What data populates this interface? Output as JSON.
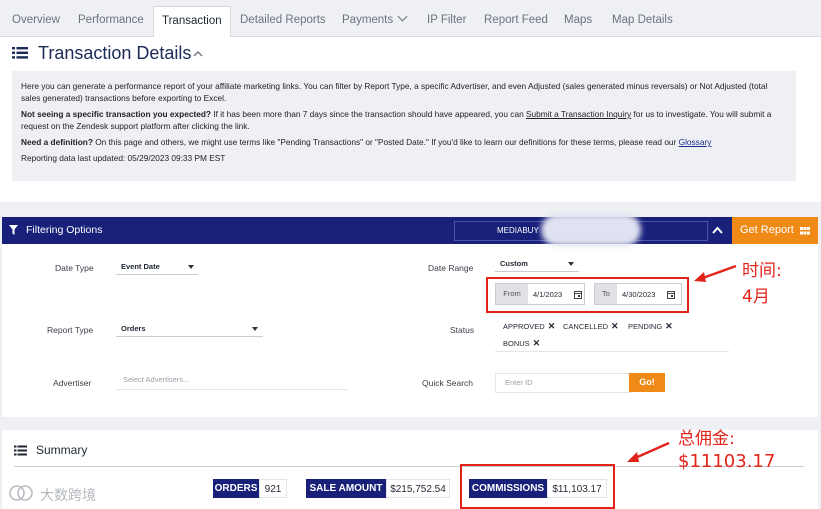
{
  "tabs": [
    {
      "label": "Overview",
      "active": false
    },
    {
      "label": "Performance",
      "active": false
    },
    {
      "label": "Transaction",
      "active": true
    },
    {
      "label": "Detailed Reports",
      "active": false
    },
    {
      "label": "Payments",
      "active": false
    },
    {
      "label": "IP Filter",
      "active": false
    },
    {
      "label": "Report Feed",
      "active": false
    },
    {
      "label": "Maps",
      "active": false
    },
    {
      "label": "Map Details",
      "active": false
    }
  ],
  "header": {
    "title": "Transaction Details"
  },
  "info": {
    "para1": "Here you can generate a performance report of your affiliate marketing links. You can filter by Report Type, a specific Advertiser, and even Adjusted (sales generated minus reversals) or Not Adjusted (total sales generated) transactions before exporting to Excel.",
    "q1_bold": "Not seeing a specific transaction you expected?",
    "q1_text_a": " If it has been more than 7 days since the transaction should have appeared, you can ",
    "q1_link": "Submit a Transaction Inquiry",
    "q1_text_b": " for us to investigate. You will submit a request on the Zendesk support platform after clicking the link.",
    "q2_bold": "Need a definition?",
    "q2_text": " On this page and others, we might use terms like \"Pending Transactions\" or \"Posted Date.\" If you'd like to learn our definitions for these terms, please read our ",
    "q2_link": "Glossary",
    "last_updated": "Reporting data last updated: 05/29/2023 09:33 PM EST"
  },
  "filter": {
    "bar_title": "Filtering Options",
    "account": "MEDIABUY",
    "get_report": "Get Report",
    "date_type_label": "Date Type",
    "date_type_value": "Event Date",
    "date_range_label": "Date Range",
    "date_range_value": "Custom",
    "from_label": "From",
    "from_value": "4/1/2023",
    "to_label": "To",
    "to_value": "4/30/2023",
    "report_type_label": "Report Type",
    "report_type_value": "Orders",
    "status_label": "Status",
    "statuses": [
      "APPROVED",
      "CANCELLED",
      "PENDING",
      "BONUS"
    ],
    "advertiser_label": "Advertiser",
    "advertiser_placeholder": "Select Advertisers...",
    "quick_search_label": "Quick Search",
    "quick_search_placeholder": "Enter ID",
    "go_label": "Go!"
  },
  "annotations": {
    "time_line1": "时间:",
    "time_line2": "4月",
    "comm_line1": "总佣金:",
    "comm_line2": "$11103.17"
  },
  "summary": {
    "title": "Summary",
    "orders_label": "ORDERS",
    "orders_value": "921",
    "sale_label": "SALE AMOUNT",
    "sale_value": "$215,752.54",
    "comm_label": "COMMISSIONS",
    "comm_value": "$11,103.17"
  },
  "watermark": "大数跨境",
  "colors": {
    "brand_navy": "#18207a",
    "accent_orange": "#f08a16",
    "annotation_red": "#e2231a"
  }
}
